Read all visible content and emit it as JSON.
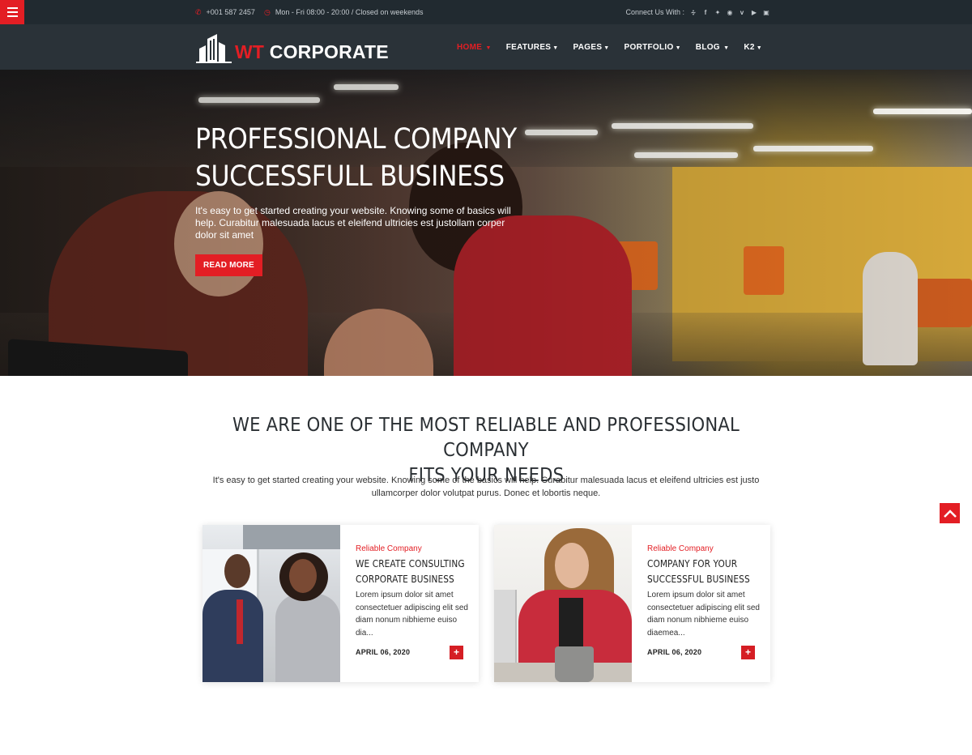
{
  "topbar": {
    "phone": "+001 587 2457",
    "hours": "Mon - Fri 08:00 - 20:00 / Closed on weekends",
    "connect_label": "Connect Us With :",
    "social": [
      {
        "name": "rss-icon",
        "glyph": ")"
      },
      {
        "name": "facebook-icon",
        "glyph": "f"
      },
      {
        "name": "twitter-icon",
        "glyph": "t"
      },
      {
        "name": "pinterest-icon",
        "glyph": "p"
      },
      {
        "name": "vimeo-icon",
        "glyph": "v"
      },
      {
        "name": "youtube-icon",
        "glyph": "y"
      },
      {
        "name": "instagram-icon",
        "glyph": "o"
      }
    ]
  },
  "logo": {
    "part1": "WT",
    "part2": "CORPORATE"
  },
  "nav": [
    {
      "label": "HOME",
      "active": true
    },
    {
      "label": "FEATURES",
      "active": false
    },
    {
      "label": "PAGES",
      "active": false
    },
    {
      "label": "PORTFOLIO",
      "active": false
    },
    {
      "label": "BLOG",
      "active": false
    },
    {
      "label": "K2",
      "active": false
    }
  ],
  "hero": {
    "title_line1": "PROFESSIONAL COMPANY",
    "title_line2": "SUCCESSFULL BUSINESS",
    "text": "It's easy to get started creating your website. Knowing some of basics will help. Curabitur malesuada lacus et eleifend ultricies est justollam corper dolor sit amet",
    "button": "READ MORE"
  },
  "intro": {
    "title_line1": "WE ARE ONE OF THE MOST RELIABLE AND PROFESSIONAL COMPANY",
    "title_line2": "FITS YOUR NEEDS",
    "text": "It's easy to get started creating your website. Knowing some of the basics will help. Curabitur malesuada lacus et eleifend ultricies est justo ullamcorper dolor volutpat purus. Donec et lobortis neque."
  },
  "cards": [
    {
      "category": "Reliable Company",
      "title_line1": "WE CREATE CONSULTING",
      "title_line2": "CORPORATE BUSINESS",
      "excerpt": "Lorem ipsum dolor sit amet consectetuer adipiscing elit sed diam nonum nibhieme euiso dia...",
      "date": "APRIL 06, 2020",
      "more": "+"
    },
    {
      "category": "Reliable Company",
      "title_line1": "COMPANY FOR YOUR",
      "title_line2": "SUCCESSFUL BUSINESS",
      "excerpt": "Lorem ipsum dolor sit amet consectetuer adipiscing elit sed diam nonum nibhieme euiso diaemea...",
      "date": "APRIL 06, 2020",
      "more": "+"
    }
  ],
  "colors": {
    "accent": "#e31e24",
    "topbar": "#212a30",
    "header": "#2a3238"
  }
}
